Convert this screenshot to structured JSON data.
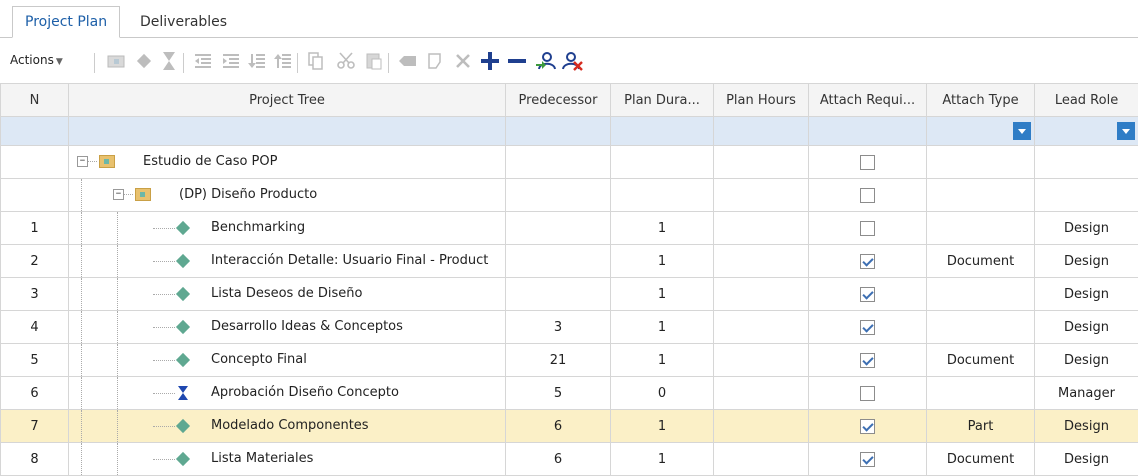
{
  "tabs": [
    {
      "label": "Project Plan",
      "active": true
    },
    {
      "label": "Deliverables",
      "active": false
    }
  ],
  "toolbar": {
    "actions_label": "Actions",
    "icons": [
      "add-folder-icon",
      "milestone-diamond-icon",
      "approval-hourglass-icon",
      "outdent-icon",
      "indent-icon",
      "move-down-icon",
      "move-up-icon",
      "copy-icon",
      "cut-icon",
      "paste-icon",
      "link-icon",
      "edit-note-icon",
      "delete-icon",
      "add-icon",
      "remove-icon",
      "assign-user-icon",
      "unassign-user-icon"
    ]
  },
  "grid": {
    "columns": [
      "N",
      "Project Tree",
      "Predecessor",
      "Plan Dura...",
      "Plan Hours",
      "Attach Requi...",
      "Attach Type",
      "Lead Role"
    ],
    "rows": [
      {
        "n": "",
        "name": "Estudio de Caso POP",
        "pred": "",
        "dur": "",
        "hours": "",
        "attach": false,
        "type": "",
        "role": "",
        "kind": "folder",
        "level": 0
      },
      {
        "n": "",
        "name": "(DP) Diseño Producto",
        "pred": "",
        "dur": "",
        "hours": "",
        "attach": false,
        "type": "",
        "role": "",
        "kind": "folder",
        "level": 1
      },
      {
        "n": "1",
        "name": "Benchmarking",
        "pred": "",
        "dur": "1",
        "hours": "",
        "attach": false,
        "type": "",
        "role": "Design",
        "kind": "task",
        "level": 2
      },
      {
        "n": "2",
        "name": "Interacción Detalle: Usuario Final - Product",
        "pred": "",
        "dur": "1",
        "hours": "",
        "attach": true,
        "type": "Document",
        "role": "Design",
        "kind": "task",
        "level": 2
      },
      {
        "n": "3",
        "name": "Lista Deseos de Diseño",
        "pred": "",
        "dur": "1",
        "hours": "",
        "attach": true,
        "type": "",
        "role": "Design",
        "kind": "task",
        "level": 2
      },
      {
        "n": "4",
        "name": "Desarrollo Ideas & Conceptos",
        "pred": "3",
        "dur": "1",
        "hours": "",
        "attach": true,
        "type": "",
        "role": "Design",
        "kind": "task",
        "level": 2
      },
      {
        "n": "5",
        "name": "Concepto Final",
        "pred": "21",
        "dur": "1",
        "hours": "",
        "attach": true,
        "type": "Document",
        "role": "Design",
        "kind": "task",
        "level": 2
      },
      {
        "n": "6",
        "name": "Aprobación Diseño Concepto",
        "pred": "5",
        "dur": "0",
        "hours": "",
        "attach": false,
        "type": "",
        "role": "Manager",
        "kind": "approval",
        "level": 2
      },
      {
        "n": "7",
        "name": "Modelado Componentes",
        "pred": "6",
        "dur": "1",
        "hours": "",
        "attach": true,
        "type": "Part",
        "role": "Design",
        "kind": "task",
        "level": 2,
        "selected": true
      },
      {
        "n": "8",
        "name": "Lista Materiales",
        "pred": "6",
        "dur": "1",
        "hours": "",
        "attach": true,
        "type": "Document",
        "role": "Design",
        "kind": "task",
        "level": 2
      }
    ]
  },
  "colors": {
    "accent": "#2f7dc6",
    "selected_row": "#fbf0c7",
    "filter_row": "#dde8f5",
    "milestone": "#5fa891"
  }
}
